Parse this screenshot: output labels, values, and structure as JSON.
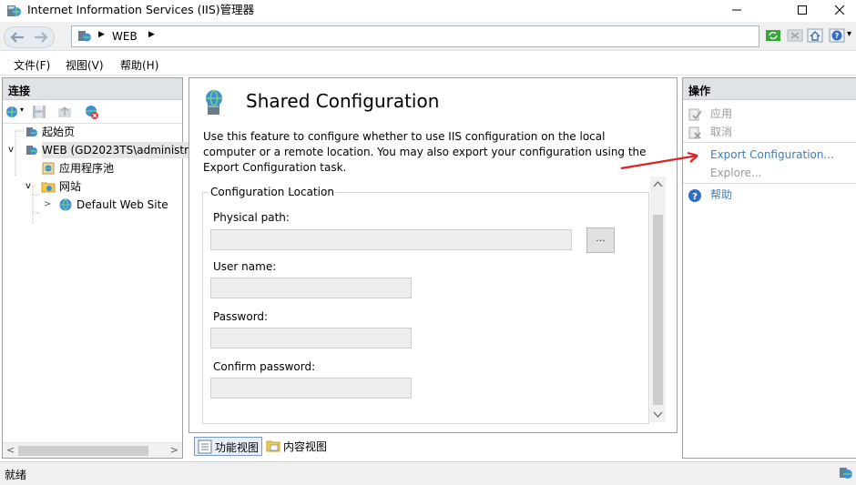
{
  "window": {
    "title": "Internet Information Services (IIS)管理器",
    "controls": {
      "minimize": "—",
      "maximize": "☐",
      "close": "✕"
    }
  },
  "address": {
    "crumbs": [
      "WEB"
    ],
    "help_menu_arrow": "▾"
  },
  "menu": {
    "items": [
      "文件(F)",
      "视图(V)",
      "帮助(H)"
    ]
  },
  "connections": {
    "header": "连接",
    "tree": [
      {
        "label": "起始页",
        "icon": "start-page-icon",
        "selected": false
      },
      {
        "label": "WEB (GD2023TS\\administr",
        "icon": "server-icon",
        "selected": true,
        "expander": "v"
      },
      {
        "label": "应用程序池",
        "icon": "app-pool-icon",
        "selected": false
      },
      {
        "label": "网站",
        "icon": "sites-folder-icon",
        "selected": false,
        "expander": "v"
      },
      {
        "label": "Default Web Site",
        "icon": "globe-icon",
        "selected": false,
        "expander": ">"
      }
    ],
    "scroll_left": "<",
    "scroll_right": ">"
  },
  "feature": {
    "title": "Shared Configuration",
    "description": "Use this feature to configure whether to use IIS configuration on the local computer or a remote location. You may also export your configuration using the Export Configuration task.",
    "group_title": "Configuration Location",
    "physical_path_label": "Physical path:",
    "physical_path_value": "",
    "browse_label": "...",
    "user_name_label": "User name:",
    "user_name_value": "",
    "password_label": "Password:",
    "password_value": "",
    "confirm_password_label": "Confirm password:",
    "confirm_password_value": ""
  },
  "view_tabs": {
    "features_view": "功能视图",
    "content_view": "内容视图"
  },
  "actions": {
    "header": "操作",
    "items": [
      {
        "label": "应用",
        "state": "disabled",
        "icon": "apply-icon"
      },
      {
        "label": "取消",
        "state": "disabled",
        "icon": "cancel-icon"
      },
      {
        "label": "Export Configuration...",
        "state": "link"
      },
      {
        "label": "Explore...",
        "state": "disabled"
      },
      {
        "label": "帮助",
        "state": "link",
        "icon": "help-icon"
      }
    ]
  },
  "status": {
    "text": "就绪"
  },
  "colors": {
    "accent_link": "#3b7dbf",
    "annotation_arrow": "#e02020",
    "pane_header": "#dfe3e8"
  }
}
